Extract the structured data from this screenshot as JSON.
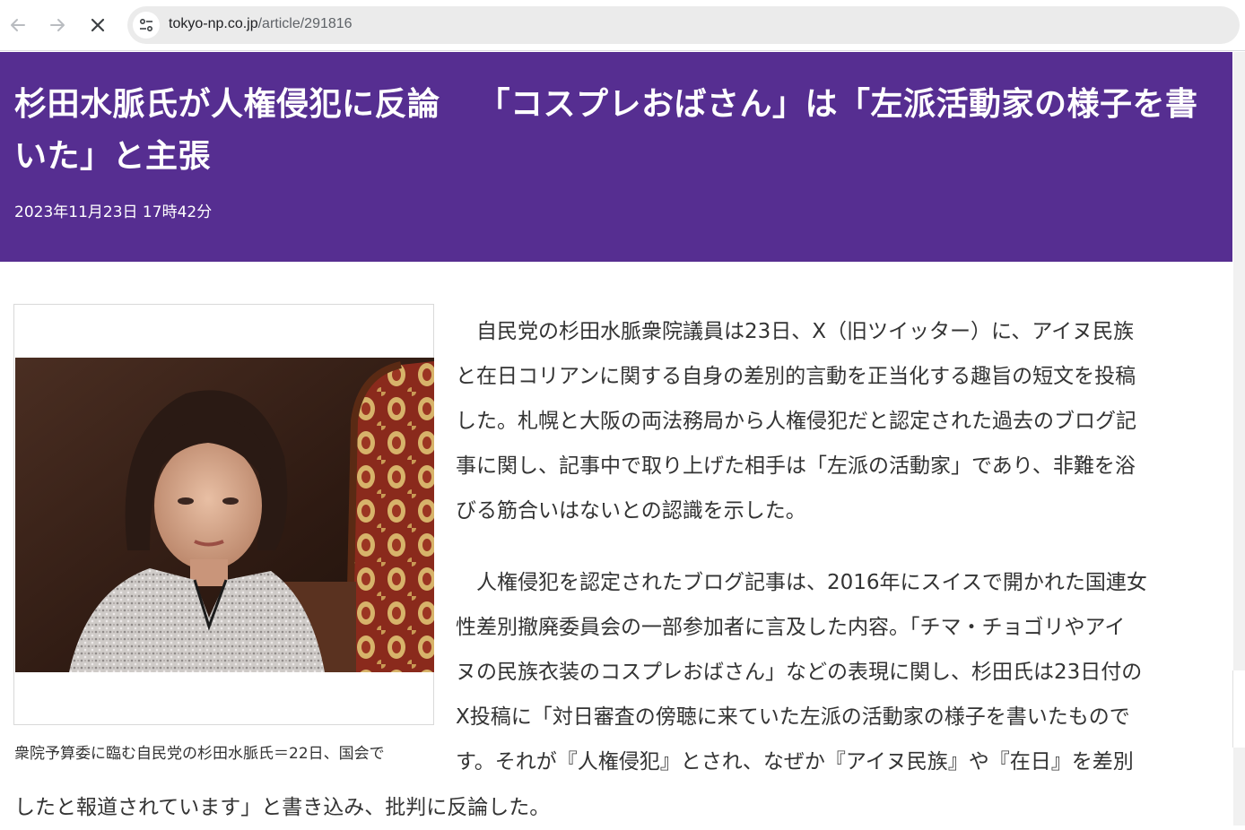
{
  "browser": {
    "back_icon": "arrow-left-icon",
    "forward_icon": "arrow-right-icon",
    "stop_icon": "close-icon",
    "site_info_icon": "tune-icon",
    "url_domain": "tokyo-np.co.jp",
    "url_path": "/article/291816"
  },
  "article": {
    "headline_part1": "杉田水脈氏が人権侵犯に反論",
    "headline_part2": "「コスプレおばさん」は「左派活動家の様子を書いた」と主張",
    "date": "2023年11月23日 17時42分",
    "photo_caption": "衆院予算委に臨む自民党の杉田水脈氏＝22日、国会で",
    "paragraph_1_lines": [
      "　自民党の杉田水脈衆院議員は23日、X（旧ツイッター）に、アイヌ民族",
      "と在日コリアンに関する自身の差別的言動を正当化する趣旨の短文を投稿",
      "した。札幌と大阪の両法務局から人権侵犯だと認定された過去のブログ記",
      "事に関し、記事中で取り上げた相手は「左派の活動家」であり、非難を浴",
      "びる筋合いはないとの認識を示した。"
    ],
    "paragraph_2_lines": [
      "　人権侵犯を認定されたブログ記事は、2016年にスイスで開かれた国連女",
      "性差別撤廃委員会の一部参加者に言及した内容。「チマ・チョゴリやアイ",
      "ヌの民族衣装のコスプレおばさん」などの表現に関し、杉田氏は23日付の",
      "X投稿に「対日審査の傍聴に来ていた左派の活動家の様子を書いたもので",
      "す。それが『人権侵犯』とされ、なぜか『アイヌ民族』や『在日』を差別"
    ],
    "paragraph_2_last_line": "したと報道されています」と書き込み、批判に反論した。"
  },
  "colors": {
    "header_band": "#562e91",
    "headline_text": "#ffffff",
    "body_text": "#333333"
  }
}
